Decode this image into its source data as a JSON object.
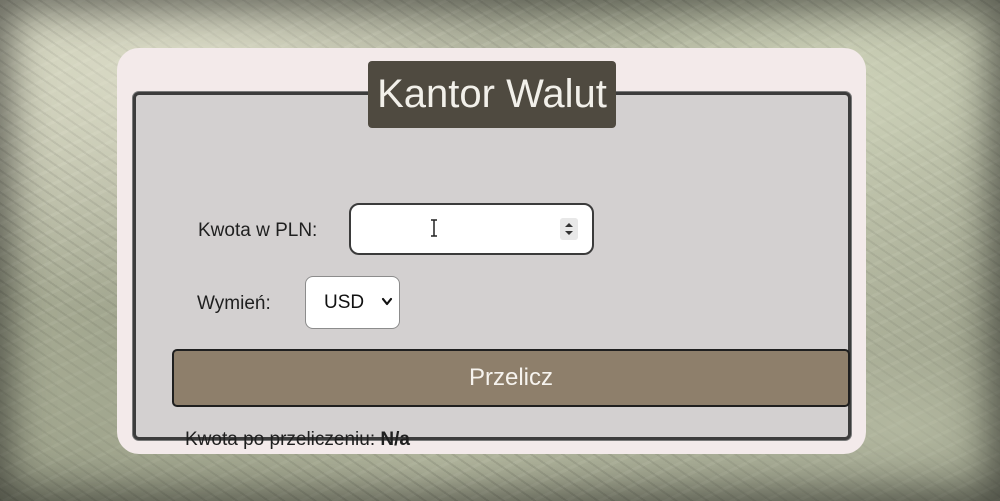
{
  "app": {
    "title": "Kantor Walut"
  },
  "form": {
    "amount_label": "Kwota w PLN:",
    "amount_value": "",
    "exchange_label": "Wymień:",
    "currency_selected": "USD",
    "submit_label": "Przelicz"
  },
  "result": {
    "label": "Kwota po przeliczeniu:",
    "value": "N/a"
  },
  "icons": {
    "cursor": "text-cursor-icon",
    "spinner": "number-spinner-icon",
    "select": "chevron-down-icon"
  },
  "colors": {
    "title_bg": "#4f4a40",
    "button_bg": "#8e7f6b",
    "panel_bg": "#d3d0d0",
    "card_bg": "#f3eaea"
  }
}
